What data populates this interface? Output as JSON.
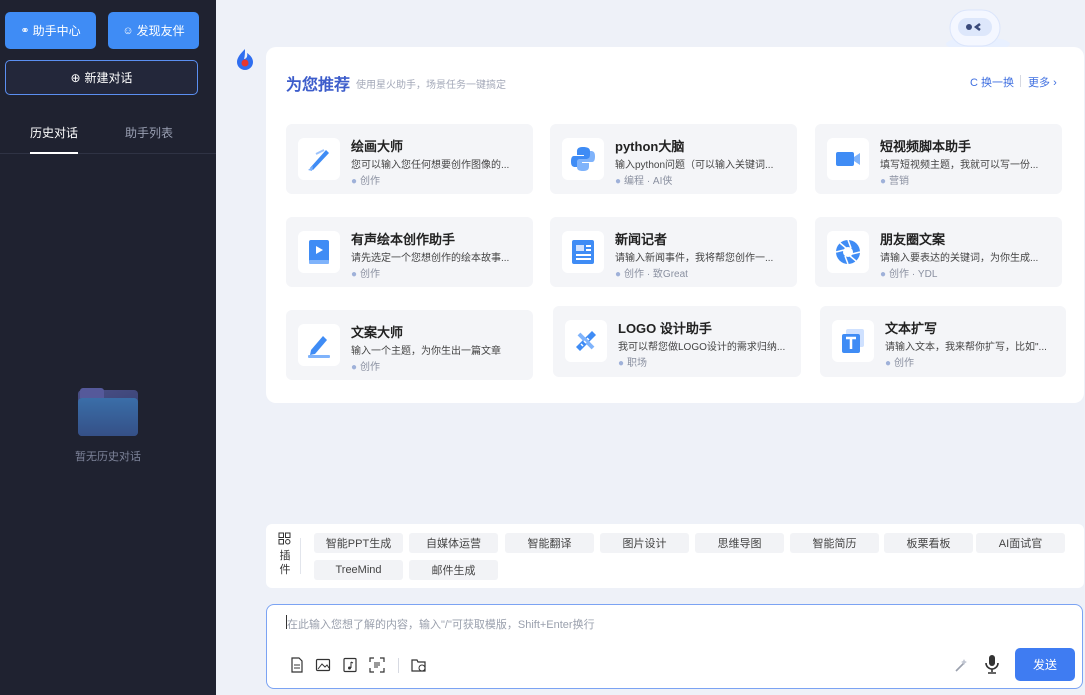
{
  "sidebar": {
    "assistant_center": "助手中心",
    "discover_partners": "发现友伴",
    "new_chat": "新建对话",
    "tabs": [
      "历史对话",
      "助手列表"
    ],
    "empty_text": "暂无历史对话"
  },
  "recommend": {
    "title": "为您推荐",
    "subtitle": "使用星火助手，场景任务一键搞定",
    "refresh": "换一换",
    "more": "更多",
    "cards": [
      {
        "name": "绘画大师",
        "desc": "您可以输入您任何想要创作图像的...",
        "meta": "创作",
        "icon": "paintbrush-icon"
      },
      {
        "name": "python大脑",
        "desc": "输入python问题（可以输入关键词...",
        "meta": "编程 · AI侠",
        "icon": "python-icon"
      },
      {
        "name": "短视频脚本助手",
        "desc": "填写短视频主题，我就可以写一份...",
        "meta": "营销",
        "icon": "video-camera-icon"
      },
      {
        "name": "有声绘本创作助手",
        "desc": "请先选定一个您想创作的绘本故事...",
        "meta": "创作",
        "icon": "audio-book-icon"
      },
      {
        "name": "新闻记者",
        "desc": "请输入新闻事件，我将帮您创作一...",
        "meta": "创作 · 致Great",
        "icon": "newspaper-icon"
      },
      {
        "name": "朋友圈文案",
        "desc": "请输入要表达的关键词，为你生成...",
        "meta": "创作 · YDL",
        "icon": "aperture-icon"
      },
      {
        "name": "文案大师",
        "desc": "输入一个主题，为你生出一篇文章",
        "meta": "创作",
        "icon": "pen-icon"
      },
      {
        "name": "LOGO 设计助手",
        "desc": "我可以帮您做LOGO设计的需求归纳...",
        "meta": "职场",
        "icon": "design-tools-icon"
      },
      {
        "name": "文本扩写",
        "desc": "请输入文本，我来帮你扩写，比如\"...",
        "meta": "创作",
        "icon": "text-expand-icon"
      }
    ]
  },
  "plugins": {
    "label": "插件",
    "chips": [
      "智能PPT生成",
      "自媒体运营",
      "智能翻译",
      "图片设计",
      "思维导图",
      "智能简历",
      "板栗看板",
      "AI面试官",
      "TreeMind",
      "邮件生成"
    ]
  },
  "input": {
    "placeholder": "在此输入您想了解的内容，输入\"/\"可获取模版，Shift+Enter换行",
    "send": "发送"
  },
  "colors": {
    "sidebar_bg": "#1f2230",
    "accent": "#3f8cf5",
    "send": "#3f7cf2"
  }
}
